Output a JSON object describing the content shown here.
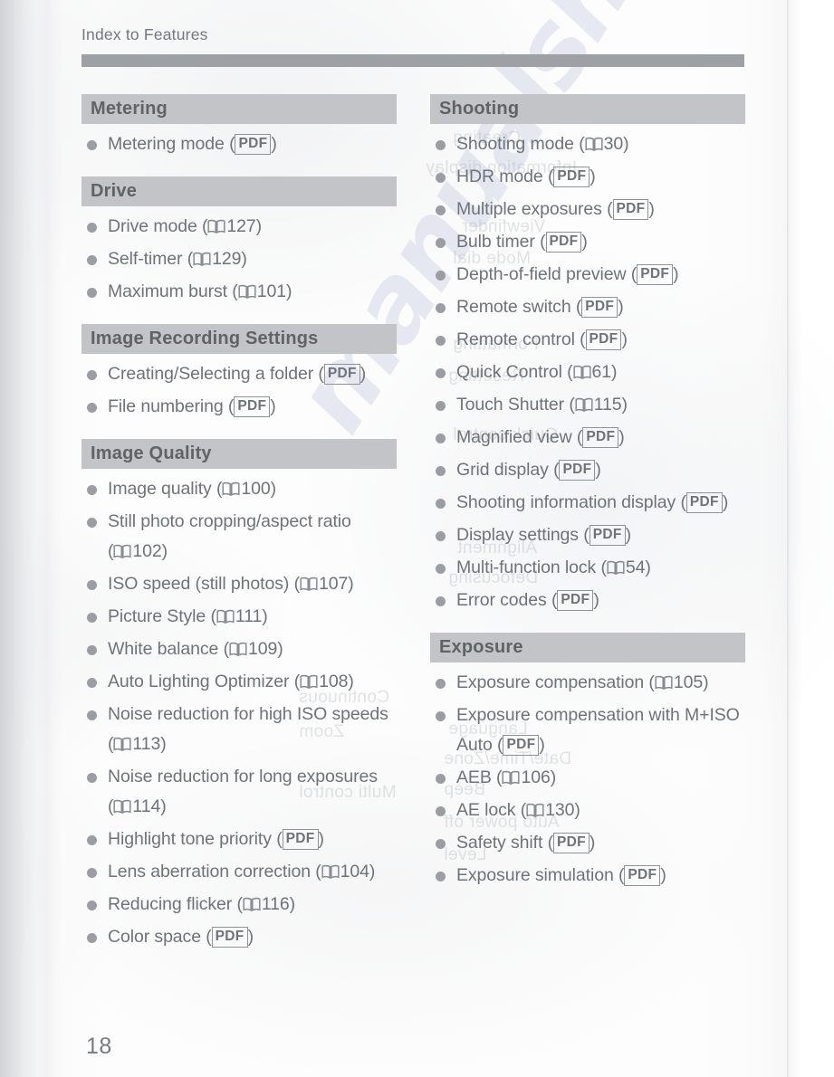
{
  "document": {
    "running_head": "Index to Features",
    "page_number": "18",
    "watermark": "manualshive"
  },
  "icons": {
    "book": "book-icon",
    "pdf": "PDF"
  },
  "columns": {
    "left": [
      {
        "id": "metering",
        "heading": "Metering",
        "items": [
          {
            "label": "Metering mode",
            "ref_type": "pdf",
            "ref": "PDF"
          }
        ]
      },
      {
        "id": "drive",
        "heading": "Drive",
        "items": [
          {
            "label": "Drive mode",
            "ref_type": "page",
            "ref": "127"
          },
          {
            "label": "Self-timer",
            "ref_type": "page",
            "ref": "129"
          },
          {
            "label": "Maximum burst",
            "ref_type": "page",
            "ref": "101"
          }
        ]
      },
      {
        "id": "image-recording-settings",
        "heading": "Image Recording Settings",
        "items": [
          {
            "label": "Creating/Selecting a folder",
            "ref_type": "pdf",
            "ref": "PDF"
          },
          {
            "label": "File numbering",
            "ref_type": "pdf",
            "ref": "PDF"
          }
        ]
      },
      {
        "id": "image-quality",
        "heading": "Image Quality",
        "items": [
          {
            "label": "Image quality",
            "ref_type": "page",
            "ref": "100"
          },
          {
            "label": "Still photo cropping/aspect ratio",
            "ref_type": "page",
            "ref": "102"
          },
          {
            "label": "ISO speed (still photos)",
            "ref_type": "page",
            "ref": "107"
          },
          {
            "label": "Picture Style",
            "ref_type": "page",
            "ref": "111"
          },
          {
            "label": "White balance",
            "ref_type": "page",
            "ref": "109"
          },
          {
            "label": "Auto Lighting Optimizer",
            "ref_type": "page",
            "ref": "108"
          },
          {
            "label": "Noise reduction for high ISO speeds",
            "ref_type": "page",
            "ref": "113"
          },
          {
            "label": "Noise reduction for long exposures",
            "ref_type": "page",
            "ref": "114"
          },
          {
            "label": "Highlight tone priority",
            "ref_type": "pdf",
            "ref": "PDF"
          },
          {
            "label": "Lens aberration correction",
            "ref_type": "page",
            "ref": "104"
          },
          {
            "label": "Reducing flicker",
            "ref_type": "page",
            "ref": "116"
          },
          {
            "label": "Color space",
            "ref_type": "pdf",
            "ref": "PDF"
          }
        ]
      }
    ],
    "right": [
      {
        "id": "shooting",
        "heading": "Shooting",
        "items": [
          {
            "label": "Shooting mode",
            "ref_type": "page",
            "ref": "30"
          },
          {
            "label": "HDR mode",
            "ref_type": "pdf",
            "ref": "PDF"
          },
          {
            "label": "Multiple exposures",
            "ref_type": "pdf",
            "ref": "PDF"
          },
          {
            "label": "Bulb timer",
            "ref_type": "pdf",
            "ref": "PDF"
          },
          {
            "label": "Depth-of-field preview",
            "ref_type": "pdf",
            "ref": "PDF"
          },
          {
            "label": "Remote switch",
            "ref_type": "pdf",
            "ref": "PDF"
          },
          {
            "label": "Remote control",
            "ref_type": "pdf",
            "ref": "PDF"
          },
          {
            "label": "Quick Control",
            "ref_type": "page",
            "ref": "61"
          },
          {
            "label": "Touch Shutter",
            "ref_type": "page",
            "ref": "115"
          },
          {
            "label": "Magnified view",
            "ref_type": "pdf",
            "ref": "PDF"
          },
          {
            "label": "Grid display",
            "ref_type": "pdf",
            "ref": "PDF"
          },
          {
            "label": "Shooting information display",
            "ref_type": "pdf",
            "ref": "PDF"
          },
          {
            "label": "Display settings",
            "ref_type": "pdf",
            "ref": "PDF"
          },
          {
            "label": "Multi-function lock",
            "ref_type": "page",
            "ref": "54"
          },
          {
            "label": "Error codes",
            "ref_type": "pdf",
            "ref": "PDF"
          }
        ]
      },
      {
        "id": "exposure",
        "heading": "Exposure",
        "items": [
          {
            "label": "Exposure compensation",
            "ref_type": "page",
            "ref": "105"
          },
          {
            "label": "Exposure compensation with M+ISO Auto",
            "ref_type": "pdf",
            "ref": "PDF"
          },
          {
            "label": "AEB",
            "ref_type": "page",
            "ref": "106"
          },
          {
            "label": "AE lock",
            "ref_type": "page",
            "ref": "130"
          },
          {
            "label": "Safety shift",
            "ref_type": "pdf",
            "ref": "PDF"
          },
          {
            "label": "Exposure simulation",
            "ref_type": "pdf",
            "ref": "PDF"
          }
        ]
      }
    ]
  },
  "colors": {
    "header_bar": "#9da0a5",
    "section_bar": "#c2c4c7",
    "text": "#6e737a",
    "bullet": "#9a9ea4",
    "watermark": "#96a3c7"
  }
}
